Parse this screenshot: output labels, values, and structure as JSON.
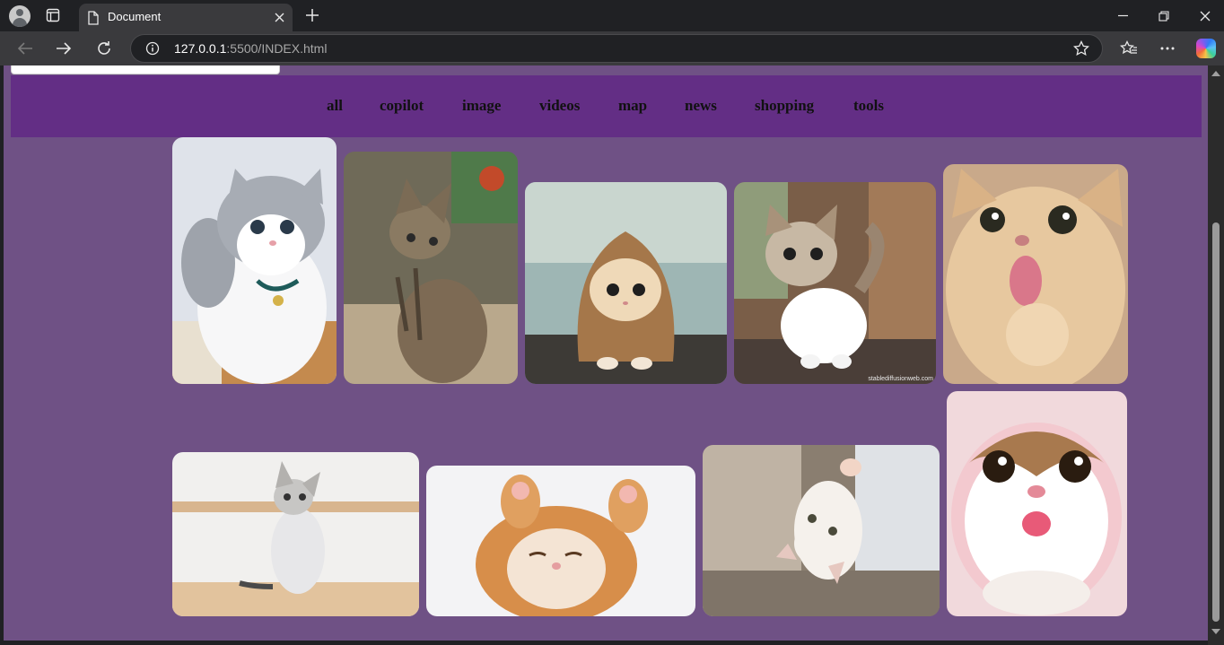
{
  "browser": {
    "tab_title": "Document",
    "url_host": "127.0.0.1",
    "url_rest": ":5500/INDEX.html"
  },
  "nav": {
    "links": [
      "all",
      "copilot",
      "image",
      "videos",
      "map",
      "news",
      "shopping",
      "tools"
    ]
  },
  "gallery": {
    "row1": [
      {
        "subject": "grey-white kitten with collar"
      },
      {
        "subject": "tabby kitten sitting"
      },
      {
        "subject": "kitten in brown hoodie"
      },
      {
        "subject": "tabby-white kitten walking",
        "watermark": "stablediffusionweb.com"
      },
      {
        "subject": "orange cat tongue out"
      }
    ],
    "row2": [
      {
        "subject": "grey-white kitten on shelf"
      },
      {
        "subject": "orange kitten sleeping"
      },
      {
        "subject": "white kitten upside down by curtain"
      },
      {
        "subject": "white kitten in pink hood"
      }
    ]
  },
  "colors": {
    "page_bg": "#6f5185",
    "navbar_bg": "#632e85",
    "nav_text": "#111111"
  }
}
